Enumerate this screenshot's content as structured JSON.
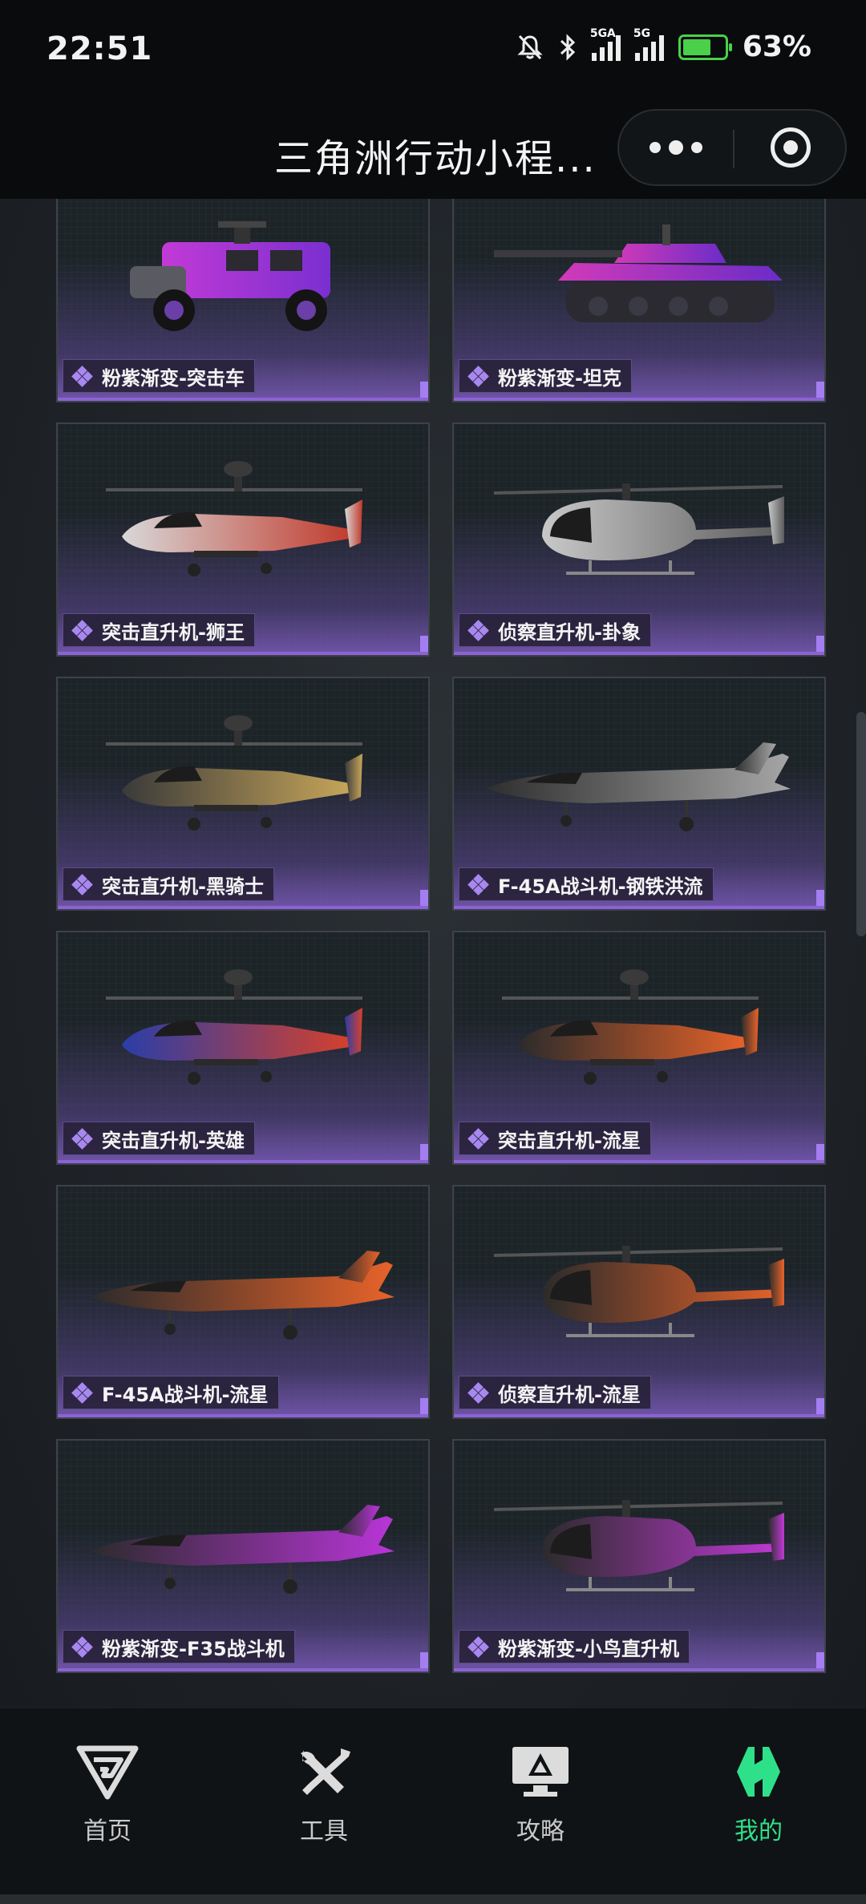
{
  "status_bar": {
    "time": "22:51",
    "network_1": "5GA",
    "network_2": "5G",
    "battery": "63%",
    "icons": [
      "mute-icon",
      "bluetooth-icon",
      "signal-icon",
      "battery-icon"
    ]
  },
  "title_bar": {
    "title": "三角洲行动小程..."
  },
  "items": [
    {
      "name": "粉紫渐变-突击车",
      "vehicle": "armored-car",
      "palette": [
        "#c23ad6",
        "#7a2fd0"
      ]
    },
    {
      "name": "粉紫渐变-坦克",
      "vehicle": "tank",
      "palette": [
        "#d23ab8",
        "#6a2cc8"
      ]
    },
    {
      "name": "突击直升机-狮王",
      "vehicle": "attack-heli",
      "palette": [
        "#d8d8d8",
        "#c0392b"
      ]
    },
    {
      "name": "侦察直升机-卦象",
      "vehicle": "scout-heli",
      "palette": [
        "#c8c8c8",
        "#5a5a5a"
      ]
    },
    {
      "name": "突击直升机-黑骑士",
      "vehicle": "attack-heli",
      "palette": [
        "#3a3a3a",
        "#c9a75a"
      ]
    },
    {
      "name": "F-45A战斗机-钢铁洪流",
      "vehicle": "jet",
      "palette": [
        "#2e2e2e",
        "#a6a6a6"
      ]
    },
    {
      "name": "突击直升机-英雄",
      "vehicle": "attack-heli",
      "palette": [
        "#2a3ea8",
        "#d8402a"
      ]
    },
    {
      "name": "突击直升机-流星",
      "vehicle": "attack-heli",
      "palette": [
        "#2b2b2b",
        "#e8632a"
      ]
    },
    {
      "name": "F-45A战斗机-流星",
      "vehicle": "jet",
      "palette": [
        "#2b2b2b",
        "#e8632a"
      ]
    },
    {
      "name": "侦察直升机-流星",
      "vehicle": "scout-heli",
      "palette": [
        "#2b2b2b",
        "#e8632a"
      ]
    },
    {
      "name": "粉紫渐变-F35战斗机",
      "vehicle": "jet",
      "palette": [
        "#2b2b2b",
        "#b935d8"
      ]
    },
    {
      "name": "粉紫渐变-小鸟直升机",
      "vehicle": "scout-heli",
      "palette": [
        "#2b2b2b",
        "#c23ad6"
      ]
    }
  ],
  "bottom_nav": [
    {
      "label": "首页",
      "icon": "home-g-icon",
      "active": false
    },
    {
      "label": "工具",
      "icon": "tools-icon",
      "active": false
    },
    {
      "label": "攻略",
      "icon": "guide-monitor-icon",
      "active": false
    },
    {
      "label": "我的",
      "icon": "profile-logo-icon",
      "active": true
    }
  ],
  "colors": {
    "accent": "#2fe08a",
    "card_gradient": "#7e5cbe",
    "tag_gem": "#a888f0"
  }
}
